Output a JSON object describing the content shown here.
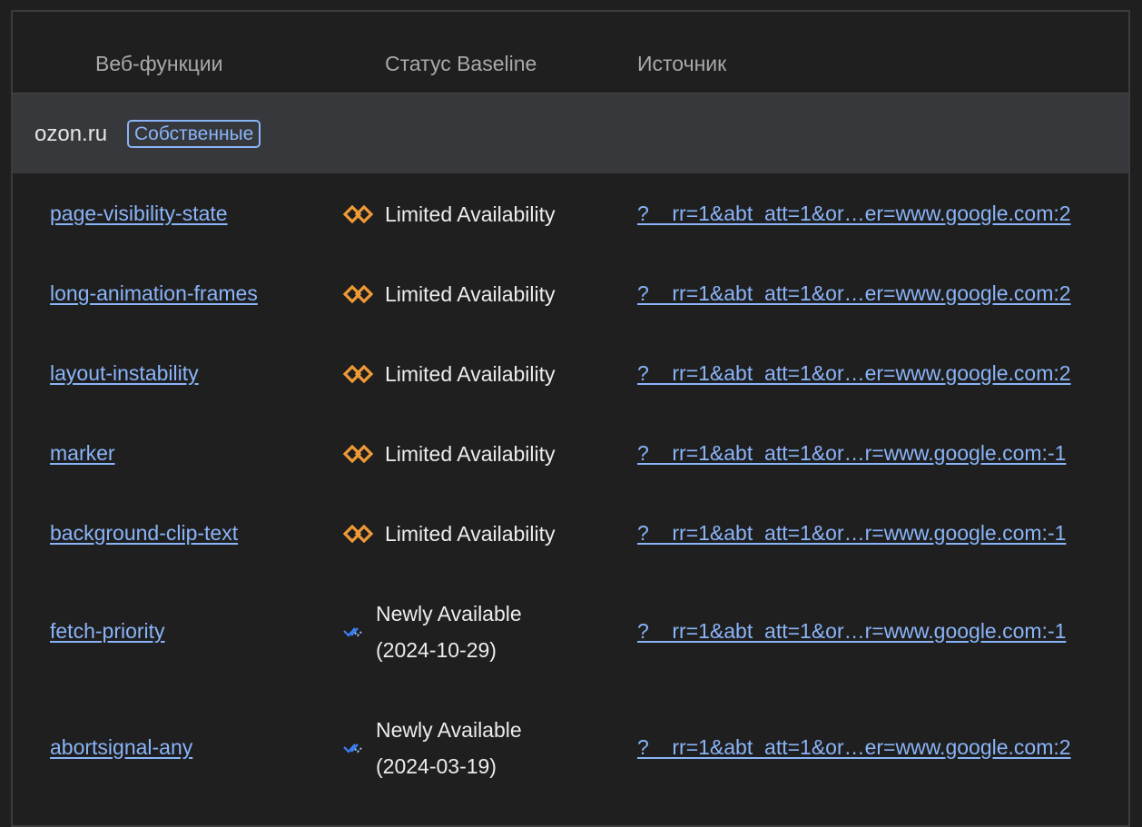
{
  "columns": {
    "features": "Веб-функции",
    "baseline_status": "Статус Baseline",
    "source": "Источник"
  },
  "group": {
    "name": "ozon.ru",
    "badge": "Собственные"
  },
  "icons": {
    "limited": "limited-availability-icon",
    "newly": "newly-available-icon"
  },
  "colors": {
    "link": "#8ab4f8",
    "limited_icon": "#f09a37",
    "newly_icon": "#3b82f6"
  },
  "rows": [
    {
      "feature": "page-visibility-state",
      "status_kind": "limited",
      "status_line1": "Limited Availability",
      "status_line2": "",
      "source": "?__rr=1&abt_att=1&or…er=www.google.com:2"
    },
    {
      "feature": "long-animation-frames",
      "status_kind": "limited",
      "status_line1": "Limited Availability",
      "status_line2": "",
      "source": "?__rr=1&abt_att=1&or…er=www.google.com:2"
    },
    {
      "feature": "layout-instability",
      "status_kind": "limited",
      "status_line1": "Limited Availability",
      "status_line2": "",
      "source": "?__rr=1&abt_att=1&or…er=www.google.com:2"
    },
    {
      "feature": "marker",
      "status_kind": "limited",
      "status_line1": "Limited Availability",
      "status_line2": "",
      "source": "?__rr=1&abt_att=1&or…r=www.google.com:-1"
    },
    {
      "feature": "background-clip-text",
      "status_kind": "limited",
      "status_line1": "Limited Availability",
      "status_line2": "",
      "source": "?__rr=1&abt_att=1&or…r=www.google.com:-1"
    },
    {
      "feature": "fetch-priority",
      "status_kind": "newly",
      "status_line1": "Newly Available",
      "status_line2": "(2024-10-29)",
      "source": "?__rr=1&abt_att=1&or…r=www.google.com:-1"
    },
    {
      "feature": "abortsignal-any",
      "status_kind": "newly",
      "status_line1": "Newly Available",
      "status_line2": "(2024-03-19)",
      "source": "?__rr=1&abt_att=1&or…er=www.google.com:2"
    }
  ]
}
